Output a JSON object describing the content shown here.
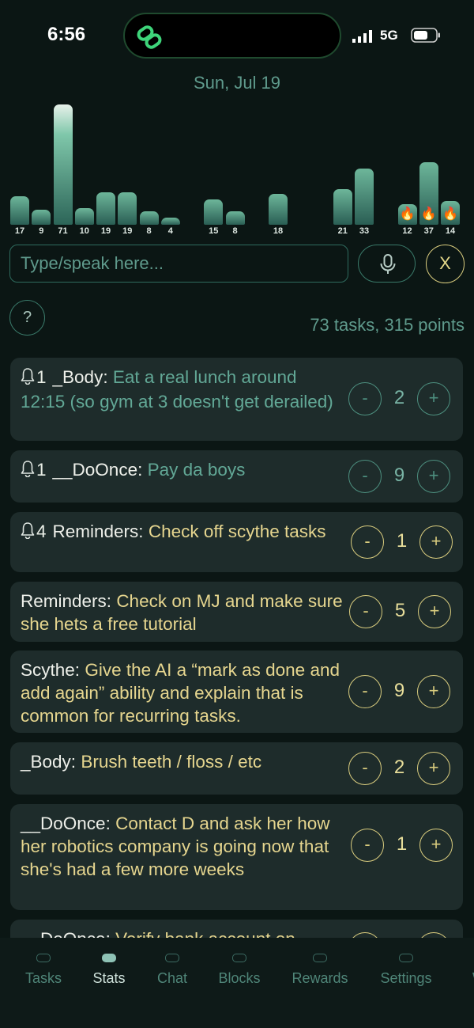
{
  "status": {
    "time": "6:56",
    "network": "5G"
  },
  "header": {
    "date": "Sun, Jul 19"
  },
  "chart_data": {
    "type": "bar",
    "values": [
      17,
      9,
      71,
      10,
      19,
      19,
      8,
      4,
      null,
      15,
      8,
      null,
      18,
      null,
      null,
      21,
      33,
      null,
      12,
      37,
      14
    ],
    "labels": [
      "17",
      "9",
      "71",
      "10",
      "19",
      "19",
      "8",
      "4",
      "",
      "15",
      "8",
      "",
      "18",
      "",
      "",
      "21",
      "33",
      "",
      "12",
      "37",
      "14"
    ],
    "streak_days": [
      18,
      19,
      20
    ],
    "streak_icon": "fire-icon"
  },
  "input": {
    "placeholder": "Type/speak here..."
  },
  "buttons": {
    "close": "X",
    "help": "?"
  },
  "summary": "73 tasks, 315 points",
  "tasks": [
    {
      "bell": "1",
      "category": "_Body:",
      "title": "Eat a real lunch around 12:15 (so gym at 3 doesn't get derailed)",
      "color": "green",
      "count": "2"
    },
    {
      "bell": "1",
      "category": "__DoOnce:",
      "title": "Pay da boys",
      "color": "green",
      "count": "9"
    },
    {
      "bell": "4",
      "category": "Reminders:",
      "title": "Check off scythe tasks",
      "color": "yellow",
      "count": "1"
    },
    {
      "category": "Reminders:",
      "title": "Check on MJ and make sure she hets a free tutorial",
      "color": "yellow",
      "count": "5"
    },
    {
      "category": "Scythe:",
      "title": "Give the AI a “mark as done and add again” ability and explain that is common for recurring tasks.",
      "color": "yellow",
      "count": "9"
    },
    {
      "category": "_Body:",
      "title": "Brush teeth / floss / etc",
      "color": "yellow",
      "count": "2"
    },
    {
      "category": "__DoOnce:",
      "title": "Contact D and ask her how her robotics company is going now that she's had a few more weeks",
      "color": "yellow",
      "count": "1"
    },
    {
      "category": "__DoOnce:",
      "title": "Verify bank account on",
      "color": "yellow",
      "count": ""
    }
  ],
  "step_labels": {
    "minus": "-",
    "plus": "+"
  },
  "tabs": [
    {
      "label": "Tasks",
      "active": false
    },
    {
      "label": "Stats",
      "active": true
    },
    {
      "label": "Chat",
      "active": false
    },
    {
      "label": "Blocks",
      "active": false
    },
    {
      "label": "Rewards",
      "active": false
    },
    {
      "label": "Settings",
      "active": false
    },
    {
      "label": "W",
      "active": false
    }
  ]
}
